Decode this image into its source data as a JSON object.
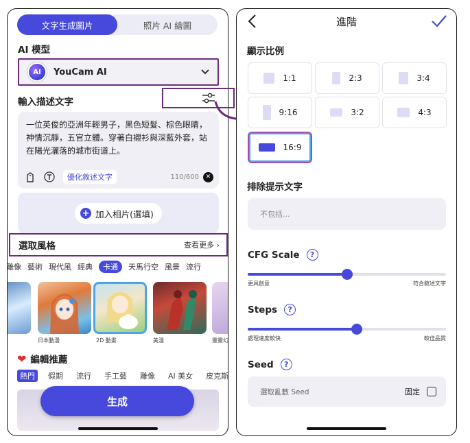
{
  "left": {
    "mode_tabs": [
      "文字生成圖片",
      "照片 AI 繪圖"
    ],
    "model_label": "AI 模型",
    "model_logo": "AI",
    "model_name": "YouCam AI",
    "prompt_label": "輸入描述文字",
    "prompt_text": "一位英俊的亞洲年輕男子，黑色短髮、棕色眼睛，神情沉靜，五官立體。穿著白襯衫與深藍外套，站在陽光灑落的城市街道上。",
    "optimize_label": "優化敘述文字",
    "char_count": "110/600",
    "add_photo_label": "加入相片(選填)",
    "style_title": "選取風格",
    "see_more": "查看更多",
    "style_categories": [
      "雕像",
      "藝術",
      "現代風",
      "經典",
      "卡通",
      "天馬行空",
      "風景",
      "流行"
    ],
    "style_cards": [
      {
        "label": ""
      },
      {
        "label": "日本動漫"
      },
      {
        "label": "2D 動畫"
      },
      {
        "label": "美漫"
      },
      {
        "label": "靈靈幻"
      }
    ],
    "recommend_title": "編輯推薦",
    "recommend_tabs": [
      "熱門",
      "假期",
      "流行",
      "手工藝",
      "雕像",
      "AI 美女",
      "皮克斯"
    ],
    "generate_label": "生成"
  },
  "right": {
    "title": "進階",
    "ratio_label": "顯示比例",
    "ratios": [
      "1:1",
      "2:3",
      "3:4",
      "9:16",
      "3:2",
      "4:3",
      "16:9"
    ],
    "selected_ratio": "16:9",
    "exclude_label": "排除提示文字",
    "exclude_placeholder": "不包括...",
    "cfg": {
      "title": "CFG Scale",
      "help": "?",
      "min_label": "更具創意",
      "max_label": "符合敘述文字",
      "value": 0.5
    },
    "steps": {
      "title": "Steps",
      "help": "?",
      "min_label": "處理速度較快",
      "max_label": "較佳品質",
      "value": 0.55
    },
    "seed": {
      "title": "Seed",
      "help": "?",
      "placeholder": "選取亂數 Seed",
      "fixed_label": "固定"
    }
  },
  "colors": {
    "accent": "#4649db",
    "highlight": "#6b2b7f",
    "selected_border": "#4aa6e4"
  }
}
